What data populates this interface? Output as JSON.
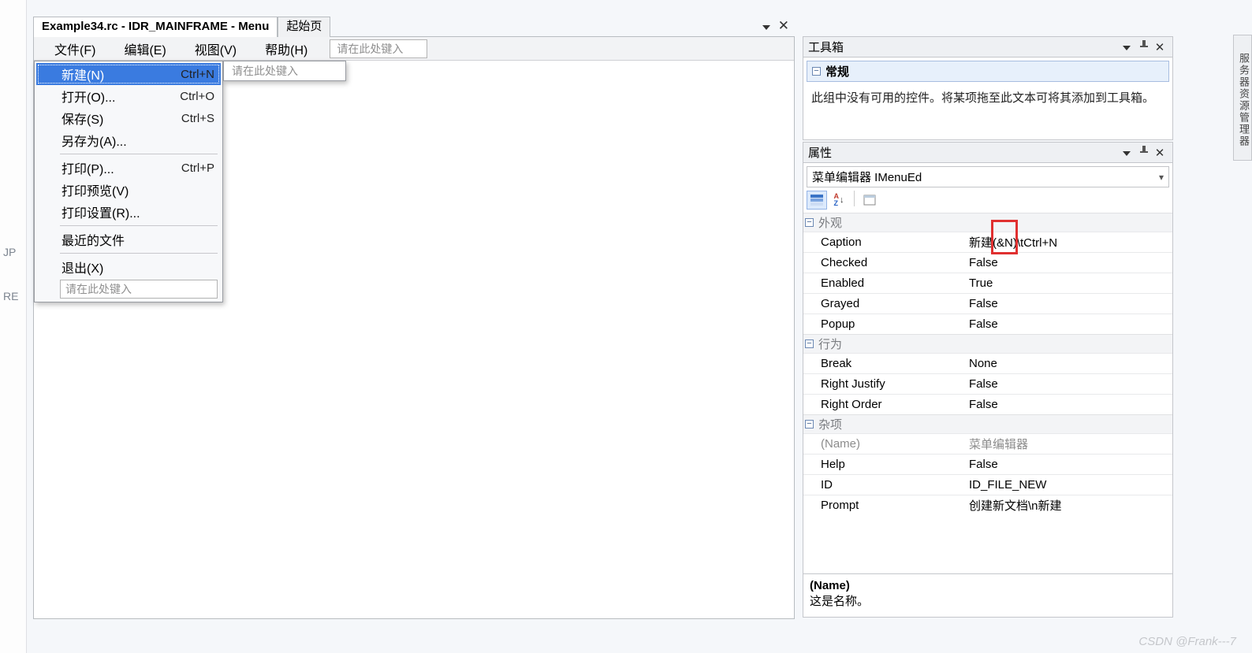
{
  "left_strip": {
    "a": "JP",
    "b": "RE"
  },
  "tabs": {
    "main": "Example34.rc - IDR_MAINFRAME - Menu",
    "start": "起始页"
  },
  "menubar": {
    "file": "文件(F)",
    "edit": "编辑(E)",
    "view": "视图(V)",
    "help": "帮助(H)",
    "type_here": "请在此处键入"
  },
  "dropdown": {
    "new": {
      "label": "新建(N)",
      "shortcut": "Ctrl+N"
    },
    "open": {
      "label": "打开(O)...",
      "shortcut": "Ctrl+O"
    },
    "save": {
      "label": "保存(S)",
      "shortcut": "Ctrl+S"
    },
    "save_as": {
      "label": "另存为(A)...",
      "shortcut": ""
    },
    "print": {
      "label": "打印(P)...",
      "shortcut": "Ctrl+P"
    },
    "print_preview": {
      "label": "打印预览(V)",
      "shortcut": ""
    },
    "print_setup": {
      "label": "打印设置(R)...",
      "shortcut": ""
    },
    "recent": {
      "label": "最近的文件",
      "shortcut": ""
    },
    "exit": {
      "label": "退出(X)",
      "shortcut": ""
    },
    "type_here": "请在此处键入",
    "sub_type_here": "请在此处键入"
  },
  "toolbox": {
    "title": "工具箱",
    "group": "常规",
    "message": "此组中没有可用的控件。将某项拖至此文本可将其添加到工具箱。"
  },
  "properties": {
    "title": "属性",
    "combo": "菜单编辑器 IMenuEd",
    "cat_appearance": "外观",
    "cat_behavior": "行为",
    "cat_misc": "杂项",
    "rows": {
      "Caption": "新建(&N)\\tCtrl+N",
      "Checked": "False",
      "Enabled": "True",
      "Grayed": "False",
      "Popup": "False",
      "Break": "None",
      "RightJustify": "False",
      "RightOrder": "False",
      "Name": "菜单编辑器",
      "Help": "False",
      "ID": "ID_FILE_NEW",
      "Prompt": "创建新文档\\n新建"
    },
    "keys": {
      "Caption": "Caption",
      "Checked": "Checked",
      "Enabled": "Enabled",
      "Grayed": "Grayed",
      "Popup": "Popup",
      "Break": "Break",
      "RightJustify": "Right Justify",
      "RightOrder": "Right Order",
      "Name": "(Name)",
      "Help": "Help",
      "ID": "ID",
      "Prompt": "Prompt"
    },
    "desc_key": "(Name)",
    "desc_val": "这是名称。"
  },
  "vtab": "服务器资源管理器",
  "watermark": "CSDN @Frank---7"
}
